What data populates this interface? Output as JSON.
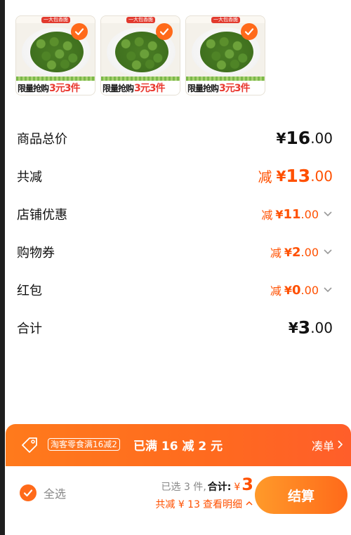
{
  "products": [
    {
      "brand_tag": "一大包香脆",
      "promo_text": "限量抢购",
      "promo_price": "3元3件",
      "checked": true
    },
    {
      "brand_tag": "一大包香脆",
      "promo_text": "限量抢购",
      "promo_price": "3元3件",
      "checked": true
    },
    {
      "brand_tag": "一大包香脆",
      "promo_text": "限量抢购",
      "promo_price": "3元3件",
      "checked": true
    }
  ],
  "summary": {
    "total_price": {
      "label": "商品总价",
      "currency": "¥",
      "integer": "16",
      "decimal": ".00"
    },
    "total_discount": {
      "label": "共减",
      "prefix": "减",
      "currency": "¥",
      "integer": "13",
      "decimal": ".00"
    },
    "store_discount": {
      "label": "店铺优惠",
      "prefix": "减",
      "currency": "¥",
      "integer": "11",
      "decimal": ".00"
    },
    "coupon": {
      "label": "购物券",
      "prefix": "减",
      "currency": "¥",
      "integer": "2",
      "decimal": ".00"
    },
    "red_packet": {
      "label": "红包",
      "prefix": "减",
      "currency": "¥",
      "integer": "0",
      "decimal": ".00"
    },
    "subtotal": {
      "label": "合计",
      "currency": "¥",
      "integer": "3",
      "decimal": ".00"
    }
  },
  "promo_bar": {
    "coupon_tag": "淘客零食满16减2",
    "status": "已满 16 减 2 元",
    "addon_label": "凑单"
  },
  "bottom_bar": {
    "select_all_label": "全选",
    "selected_count": "已选 3 件",
    "separator": ",",
    "sum_label": "合计:",
    "sum_currency": "¥",
    "sum_value": "3",
    "discount_line": "共减 ¥ 13",
    "detail_label": "查看明细",
    "checkout_label": "结算"
  },
  "colors": {
    "accent": "#ff5000",
    "accent_gradient_start": "#ff9a2a",
    "accent_gradient_end": "#ff6a1a"
  },
  "icons": [
    "checkmark-icon",
    "coupon-tag-icon",
    "chevron-right-icon",
    "chevron-down-icon",
    "chevron-up-icon"
  ]
}
